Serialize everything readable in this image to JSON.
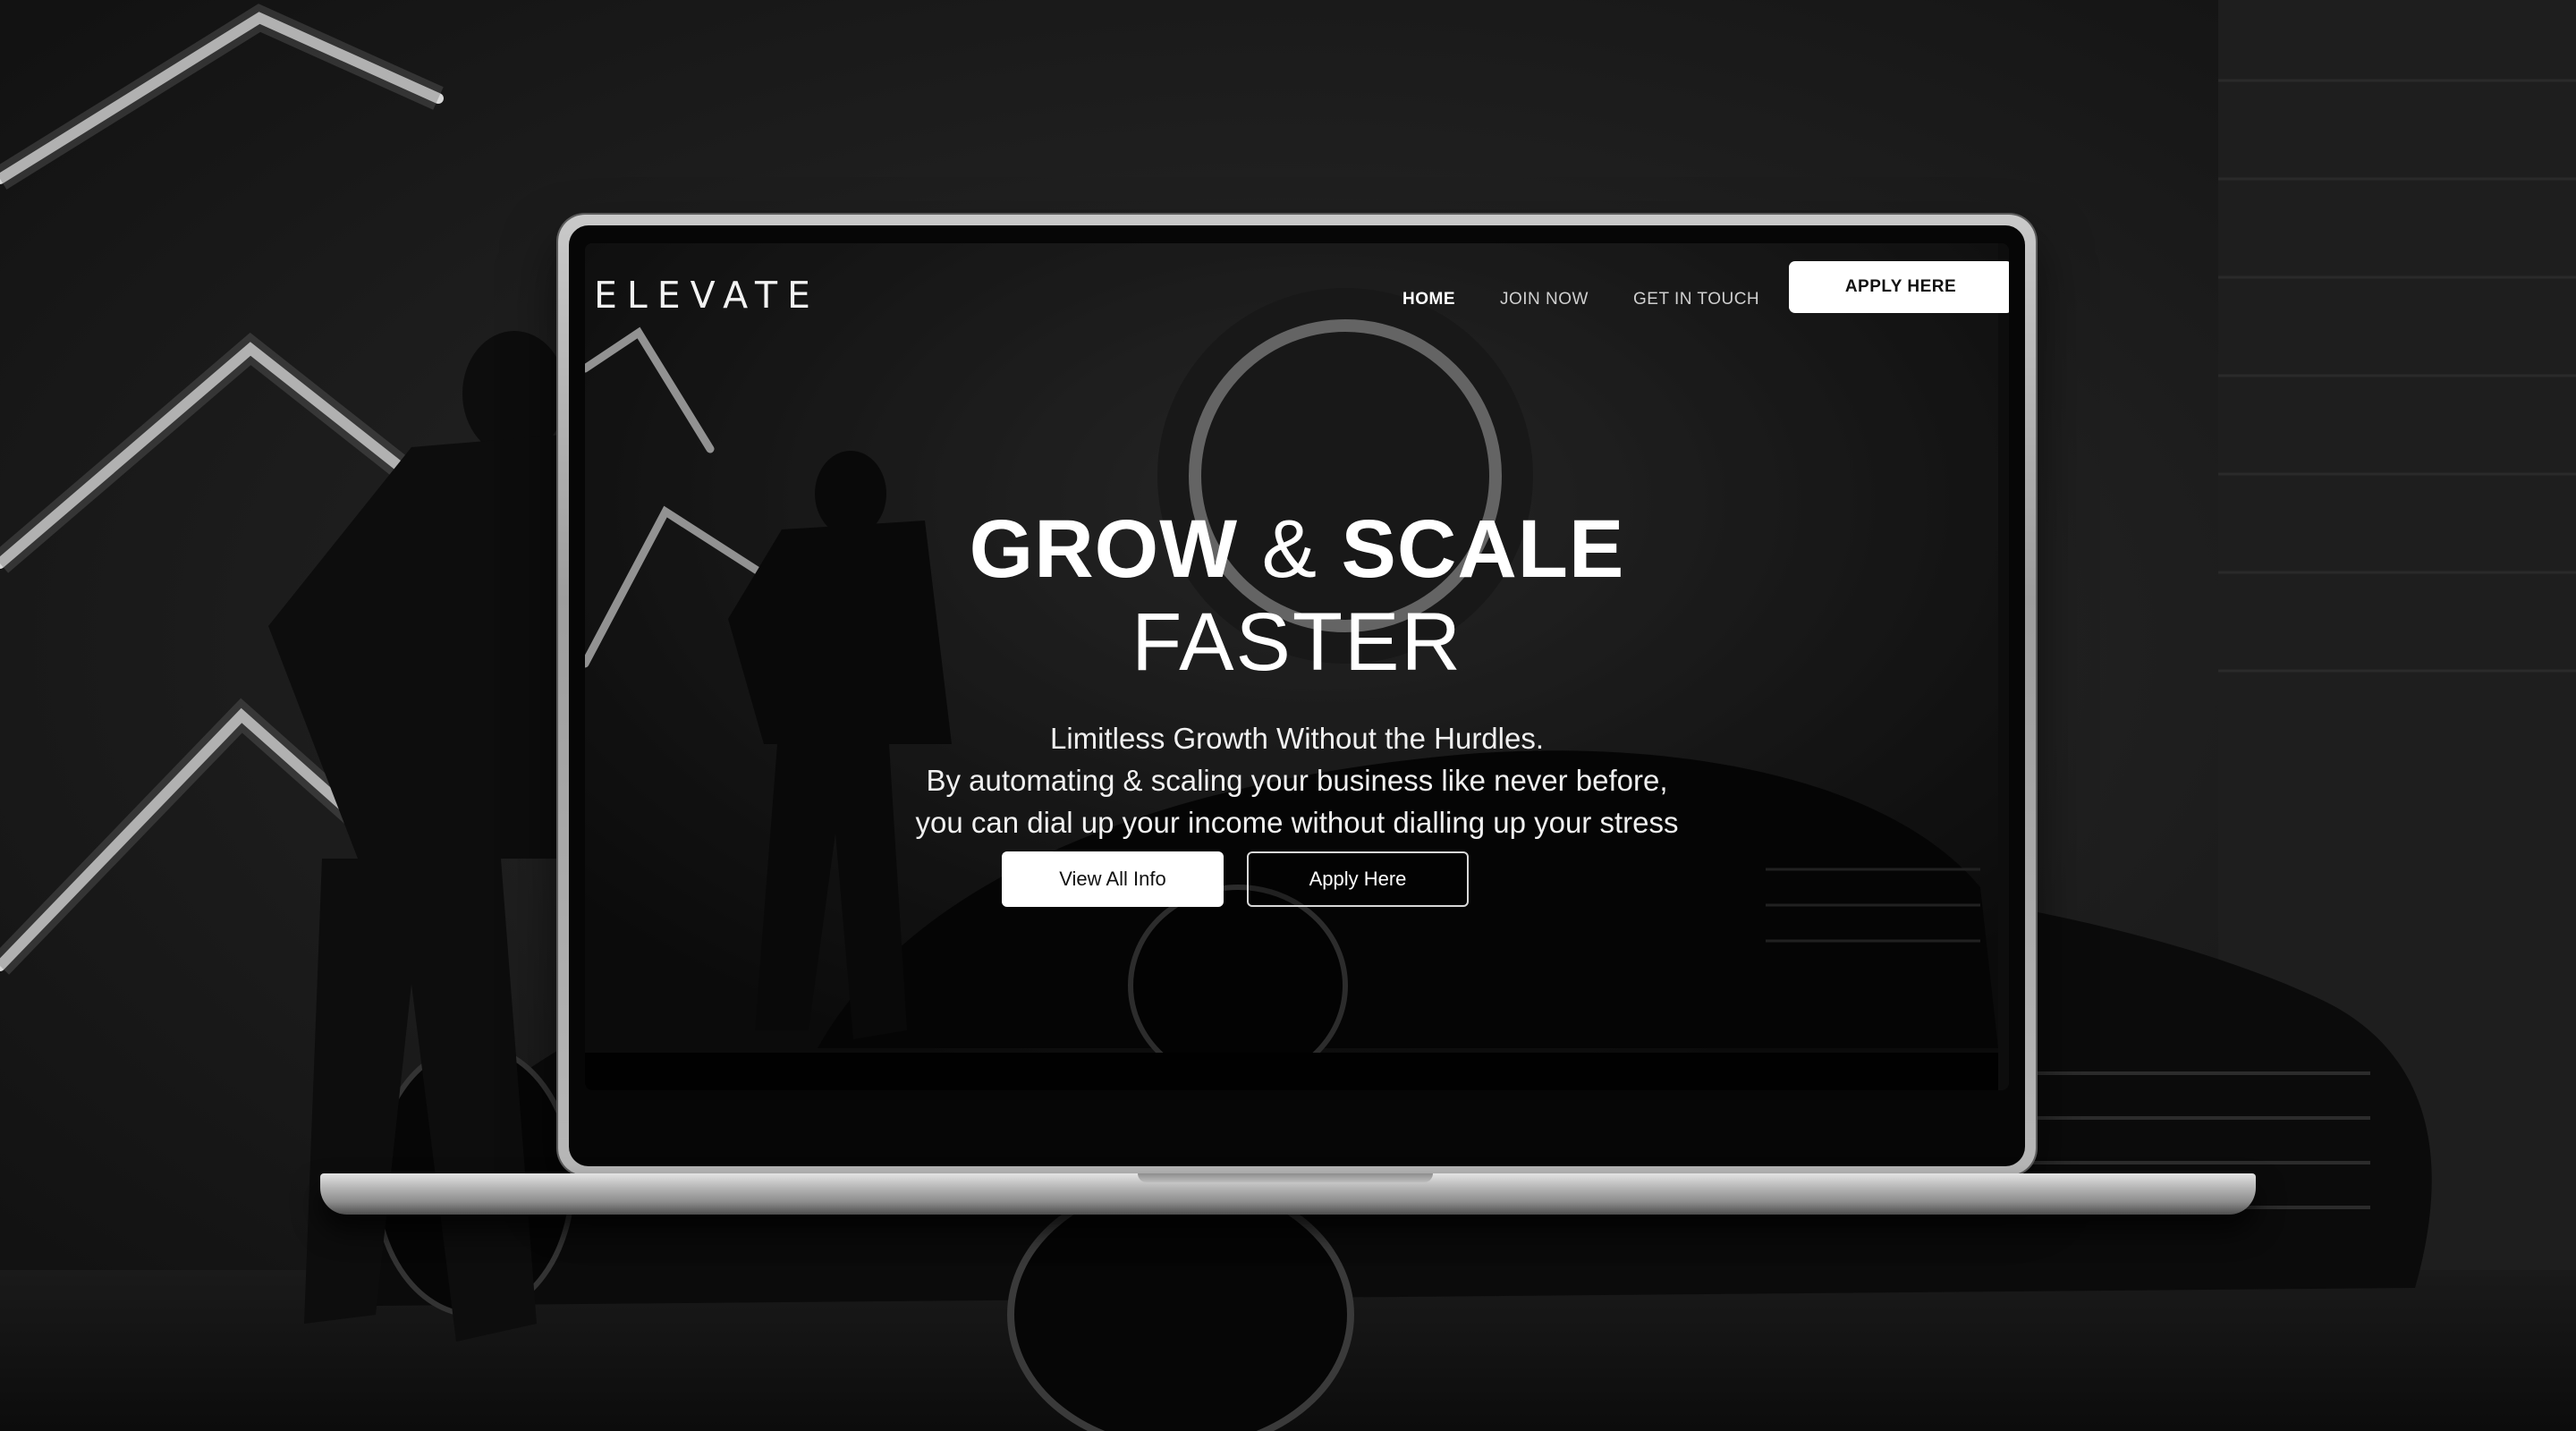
{
  "site": {
    "logo": "ELEVATE"
  },
  "nav": {
    "links": [
      {
        "label": "HOME",
        "active": true
      },
      {
        "label": "JOIN NOW",
        "active": false
      },
      {
        "label": "GET IN TOUCH",
        "active": false
      }
    ],
    "cta_label": "APPLY HERE"
  },
  "hero": {
    "title_part1": "GROW",
    "title_amp": "&",
    "title_part2": "SCALE",
    "title_line2": "FASTER",
    "subtitle_lines": [
      "Limitless Growth Without the Hurdles.",
      "By automating & scaling your business like never before,",
      "you can dial up your income without dialling up your stress"
    ],
    "primary_button": "View All Info",
    "secondary_button": "Apply Here"
  },
  "colors": {
    "background": "#1b1b1b",
    "accent": "#ffffff",
    "laptop_frame": "#b0b0b0"
  }
}
